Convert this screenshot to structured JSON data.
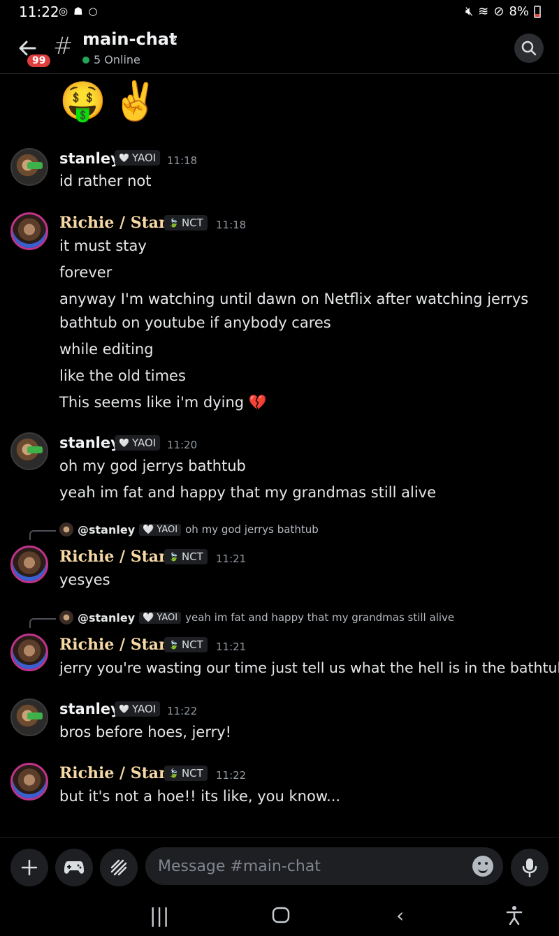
{
  "status": {
    "time": "11:22",
    "battery": "8%"
  },
  "header": {
    "badge": "99",
    "channel": "main-chat",
    "online": "5 Online"
  },
  "top_emojis": [
    "🤑",
    "✌️"
  ],
  "messages": [
    {
      "author": "stanley",
      "tag": "YAOI",
      "time": "11:18",
      "lines": [
        "id rather not"
      ]
    },
    {
      "author": "Richie / Stan .",
      "tag": "NCT",
      "time": "11:18",
      "lines": [
        "it must stay",
        "forever",
        "anyway I'm watching until dawn on Netflix after watching jerrys",
        "bathtub on youtube if anybody cares",
        "while editing",
        "like the old times",
        "This seems like i'm dying 💔"
      ]
    },
    {
      "author": "stanley",
      "tag": "YAOI",
      "time": "11:20",
      "lines": [
        "oh my god jerrys bathtub",
        "yeah im fat and happy that my grandmas still alive"
      ]
    },
    {
      "reply_user": "@stanley",
      "reply_tag": "YAOI",
      "reply_text": "oh my god jerrys bathtub",
      "author": "Richie / Stan .",
      "tag": "NCT",
      "time": "11:21",
      "lines": [
        "yesyes"
      ]
    },
    {
      "reply_user": "@stanley",
      "reply_tag": "YAOI",
      "reply_text": "yeah im fat and happy that my grandmas still alive",
      "author": "Richie / Stan .",
      "tag": "NCT",
      "time": "11:21",
      "lines": [
        "jerry you're wasting our time just tell us what the hell is in the bathtub"
      ]
    },
    {
      "author": "stanley",
      "tag": "YAOI",
      "time": "11:22",
      "lines": [
        "bros before hoes, jerry!"
      ]
    },
    {
      "author": "Richie / Stan .",
      "tag": "NCT",
      "time": "11:22",
      "lines": [
        "but it's not a hoe!! its like, you know..."
      ]
    }
  ],
  "composer": {
    "placeholder": "Message #main-chat"
  },
  "colors": {
    "accent_online": "#23a55a",
    "badge": "#e03e3e",
    "richie_name": "#f6d9a5"
  }
}
